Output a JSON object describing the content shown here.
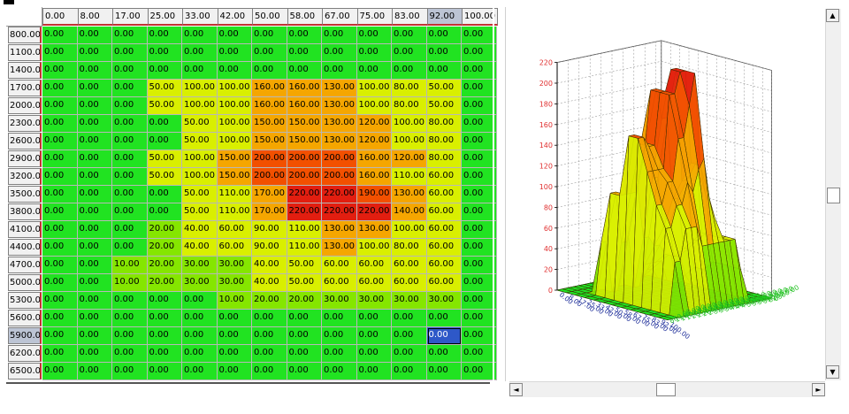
{
  "columns": [
    "0.00",
    "8.00",
    "17.00",
    "25.00",
    "33.00",
    "42.00",
    "50.00",
    "58.00",
    "67.00",
    "75.00",
    "83.00",
    "92.00",
    "100.00"
  ],
  "rows": [
    "800.00",
    "1100.00",
    "1400.00",
    "1700.00",
    "2000.00",
    "2300.00",
    "2600.00",
    "2900.00",
    "3200.00",
    "3500.00",
    "3800.00",
    "4100.00",
    "4400.00",
    "4700.00",
    "5000.00",
    "5300.00",
    "5600.00",
    "5900.00",
    "6200.00",
    "6500.00"
  ],
  "cells": [
    [
      "0.00",
      "0.00",
      "0.00",
      "0.00",
      "0.00",
      "0.00",
      "0.00",
      "0.00",
      "0.00",
      "0.00",
      "0.00",
      "0.00",
      "0.00"
    ],
    [
      "0.00",
      "0.00",
      "0.00",
      "0.00",
      "0.00",
      "0.00",
      "0.00",
      "0.00",
      "0.00",
      "0.00",
      "0.00",
      "0.00",
      "0.00"
    ],
    [
      "0.00",
      "0.00",
      "0.00",
      "0.00",
      "0.00",
      "0.00",
      "0.00",
      "0.00",
      "0.00",
      "0.00",
      "0.00",
      "0.00",
      "0.00"
    ],
    [
      "0.00",
      "0.00",
      "0.00",
      "50.00",
      "100.00",
      "100.00",
      "160.00",
      "160.00",
      "130.00",
      "100.00",
      "80.00",
      "50.00",
      "0.00"
    ],
    [
      "0.00",
      "0.00",
      "0.00",
      "50.00",
      "100.00",
      "100.00",
      "160.00",
      "160.00",
      "130.00",
      "100.00",
      "80.00",
      "50.00",
      "0.00"
    ],
    [
      "0.00",
      "0.00",
      "0.00",
      "0.00",
      "50.00",
      "100.00",
      "150.00",
      "150.00",
      "130.00",
      "120.00",
      "100.00",
      "80.00",
      "0.00"
    ],
    [
      "0.00",
      "0.00",
      "0.00",
      "0.00",
      "50.00",
      "100.00",
      "150.00",
      "150.00",
      "130.00",
      "120.00",
      "100.00",
      "80.00",
      "0.00"
    ],
    [
      "0.00",
      "0.00",
      "0.00",
      "50.00",
      "100.00",
      "150.00",
      "200.00",
      "200.00",
      "200.00",
      "160.00",
      "120.00",
      "80.00",
      "0.00"
    ],
    [
      "0.00",
      "0.00",
      "0.00",
      "50.00",
      "100.00",
      "150.00",
      "200.00",
      "200.00",
      "200.00",
      "160.00",
      "110.00",
      "60.00",
      "0.00"
    ],
    [
      "0.00",
      "0.00",
      "0.00",
      "0.00",
      "50.00",
      "110.00",
      "170.00",
      "220.00",
      "220.00",
      "190.00",
      "130.00",
      "60.00",
      "0.00"
    ],
    [
      "0.00",
      "0.00",
      "0.00",
      "0.00",
      "50.00",
      "110.00",
      "170.00",
      "220.00",
      "220.00",
      "220.00",
      "140.00",
      "60.00",
      "0.00"
    ],
    [
      "0.00",
      "0.00",
      "0.00",
      "20.00",
      "40.00",
      "60.00",
      "90.00",
      "110.00",
      "130.00",
      "130.00",
      "100.00",
      "60.00",
      "0.00"
    ],
    [
      "0.00",
      "0.00",
      "0.00",
      "20.00",
      "40.00",
      "60.00",
      "90.00",
      "110.00",
      "130.00",
      "100.00",
      "80.00",
      "60.00",
      "0.00"
    ],
    [
      "0.00",
      "0.00",
      "10.00",
      "20.00",
      "30.00",
      "30.00",
      "40.00",
      "50.00",
      "60.00",
      "60.00",
      "60.00",
      "60.00",
      "0.00"
    ],
    [
      "0.00",
      "0.00",
      "10.00",
      "20.00",
      "30.00",
      "30.00",
      "40.00",
      "50.00",
      "60.00",
      "60.00",
      "60.00",
      "60.00",
      "0.00"
    ],
    [
      "0.00",
      "0.00",
      "0.00",
      "0.00",
      "0.00",
      "10.00",
      "20.00",
      "20.00",
      "30.00",
      "30.00",
      "30.00",
      "30.00",
      "0.00"
    ],
    [
      "0.00",
      "0.00",
      "0.00",
      "0.00",
      "0.00",
      "0.00",
      "0.00",
      "0.00",
      "0.00",
      "0.00",
      "0.00",
      "0.00",
      "0.00"
    ],
    [
      "0.00",
      "0.00",
      "0.00",
      "0.00",
      "0.00",
      "0.00",
      "0.00",
      "0.00",
      "0.00",
      "0.00",
      "0.00",
      "0.00",
      "0.00"
    ],
    [
      "0.00",
      "0.00",
      "0.00",
      "0.00",
      "0.00",
      "0.00",
      "0.00",
      "0.00",
      "0.00",
      "0.00",
      "0.00",
      "0.00",
      "0.00"
    ],
    [
      "0.00",
      "0.00",
      "0.00",
      "0.00",
      "0.00",
      "0.00",
      "0.00",
      "0.00",
      "0.00",
      "0.00",
      "0.00",
      "0.00",
      "0.00"
    ]
  ],
  "selected": {
    "row_label": "5900.00",
    "col_label": "92.00"
  },
  "chart_data": {
    "type": "surface3d",
    "z_axis_ticks": [
      "0",
      "20",
      "40",
      "60",
      "80",
      "100",
      "120",
      "140",
      "160",
      "180",
      "200",
      "220"
    ],
    "x_axis_ticks": [
      "0.00",
      "8.00",
      "17.00",
      "25.00",
      "33.00",
      "42.00",
      "50.00",
      "58.00",
      "67.00",
      "75.00",
      "83.00",
      "92.00",
      "100.00"
    ],
    "y_axis_ticks": [
      "800.00",
      "1100.00",
      "1400.00",
      "1700.00",
      "2000.00",
      "2300.00",
      "2600.00",
      "2900.00",
      "3200.00",
      "3500.00",
      "3800.00",
      "4100.00",
      "4400.00",
      "4700.00",
      "5000.00",
      "5300.00",
      "5600.00",
      "5900.00",
      "6200.00",
      "6500.00"
    ],
    "zlim": [
      0,
      220
    ],
    "grid": true,
    "color_scale": [
      "#21e321",
      "#85e600",
      "#d9ef00",
      "#f5a600",
      "#f25000",
      "#e21e10"
    ]
  },
  "scroll_icons": {
    "up": "▲",
    "down": "▼",
    "left": "◄",
    "right": "►"
  }
}
